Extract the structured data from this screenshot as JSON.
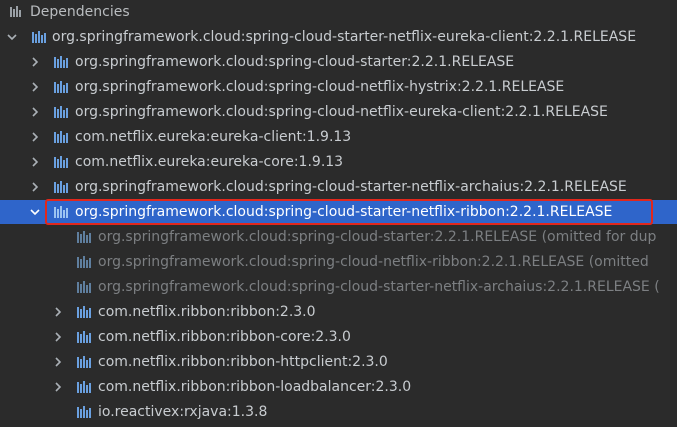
{
  "colors": {
    "background": "#2b2b2b",
    "selection": "#2f65ca",
    "text": "#c8ccd0",
    "omitted_text": "#7c7f82",
    "highlight_border": "#e2271c",
    "library_icon": "#6aa0e0"
  },
  "tree": {
    "header": "Dependencies",
    "root": "org.springframework.cloud:spring-cloud-starter-netflix-eureka-client:2.2.1.RELEASE",
    "children": [
      "org.springframework.cloud:spring-cloud-starter:2.2.1.RELEASE",
      "org.springframework.cloud:spring-cloud-netflix-hystrix:2.2.1.RELEASE",
      "org.springframework.cloud:spring-cloud-netflix-eureka-client:2.2.1.RELEASE",
      "com.netflix.eureka:eureka-client:1.9.13",
      "com.netflix.eureka:eureka-core:1.9.13",
      "org.springframework.cloud:spring-cloud-starter-netflix-archaius:2.2.1.RELEASE"
    ],
    "selected": "org.springframework.cloud:spring-cloud-starter-netflix-ribbon:2.2.1.RELEASE",
    "selected_children": [
      "org.springframework.cloud:spring-cloud-starter:2.2.1.RELEASE (omitted for dup",
      "org.springframework.cloud:spring-cloud-netflix-ribbon:2.2.1.RELEASE (omitted",
      "org.springframework.cloud:spring-cloud-starter-netflix-archaius:2.2.1.RELEASE (",
      "com.netflix.ribbon:ribbon:2.3.0",
      "com.netflix.ribbon:ribbon-core:2.3.0",
      "com.netflix.ribbon:ribbon-httpclient:2.3.0",
      "com.netflix.ribbon:ribbon-loadbalancer:2.3.0",
      "io.reactivex:rxjava:1.3.8"
    ]
  },
  "icons": {
    "expand": "chevron-right-icon",
    "collapse": "chevron-down-icon",
    "library": "library-icon"
  }
}
